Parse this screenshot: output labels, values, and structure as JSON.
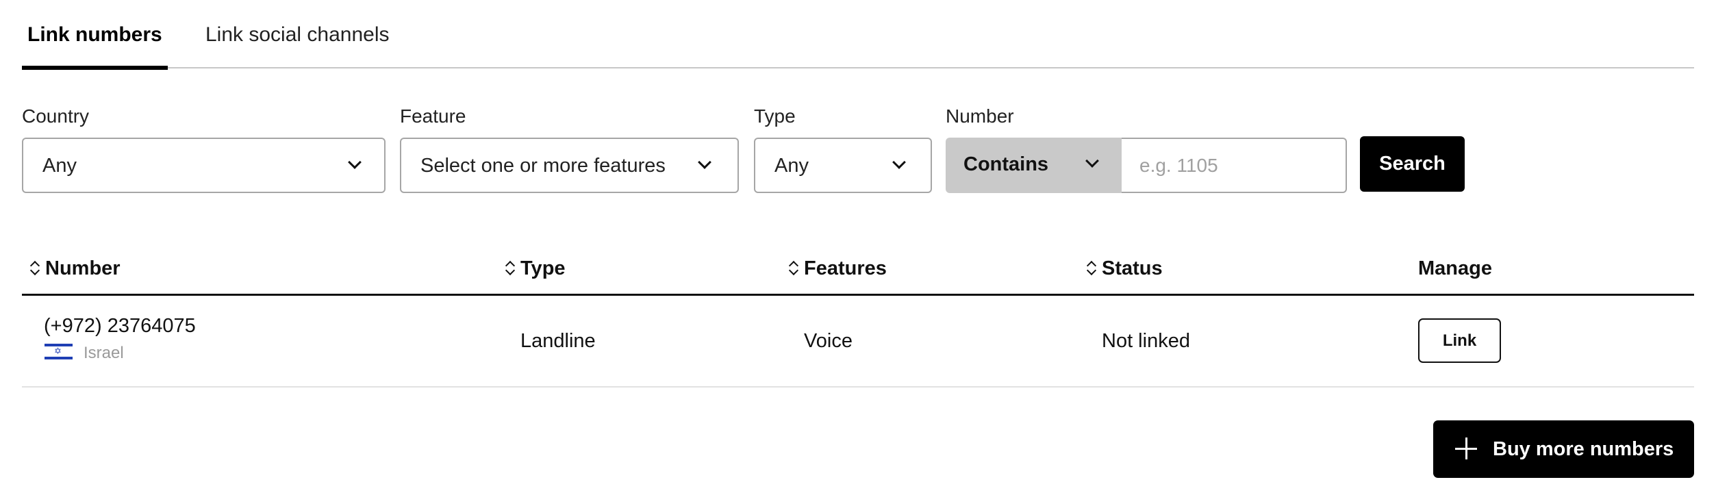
{
  "tabs": [
    {
      "label": "Link numbers",
      "active": true
    },
    {
      "label": "Link social channels",
      "active": false
    }
  ],
  "filters": {
    "country": {
      "label": "Country",
      "value": "Any"
    },
    "feature": {
      "label": "Feature",
      "value": "Select one or more features"
    },
    "type": {
      "label": "Type",
      "value": "Any"
    },
    "number": {
      "label": "Number",
      "match_mode": "Contains",
      "value": "",
      "placeholder": "e.g. 1105"
    },
    "search_label": "Search"
  },
  "table": {
    "columns": [
      {
        "label": "Number",
        "sortable": true
      },
      {
        "label": "Type",
        "sortable": true
      },
      {
        "label": "Features",
        "sortable": true
      },
      {
        "label": "Status",
        "sortable": true
      },
      {
        "label": "Manage",
        "sortable": false
      }
    ],
    "rows": [
      {
        "number": "(+972) 23764075",
        "country": "Israel",
        "flag_icon": "israel-flag-icon",
        "type": "Landline",
        "features": "Voice",
        "status": "Not linked",
        "action_label": "Link"
      }
    ]
  },
  "buy_more_label": "Buy more numbers",
  "colors": {
    "primary": "#000000",
    "border": "#a6a6a6",
    "muted": "#9a9a9a",
    "contains_bg": "#c9c9c9",
    "flag_blue": "#1f3fb4"
  }
}
